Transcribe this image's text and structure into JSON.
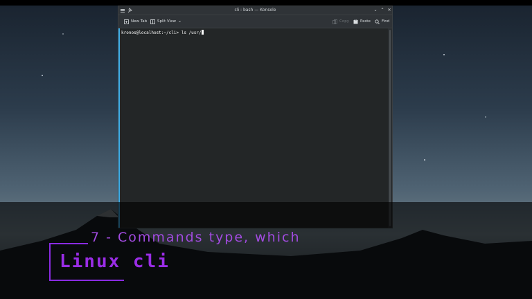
{
  "window": {
    "title": "cli : bash — Konsole",
    "controls": [
      "chevron-down-icon",
      "chevron-up-icon",
      "close-icon"
    ]
  },
  "toolbar": {
    "new_tab": "New Tab",
    "split_view": "Split View",
    "copy": "Copy",
    "paste": "Paste",
    "find": "Find"
  },
  "terminal": {
    "prompt": "kronos@localhost:~/cli> ",
    "command": "ls /usr/"
  },
  "overlay": {
    "chapter": "7 - Commands type, which",
    "brand": "Linux cli"
  },
  "colors": {
    "accent": "#3daee9",
    "brand_purple": "#9a2de6",
    "terminal_bg": "#232627"
  }
}
